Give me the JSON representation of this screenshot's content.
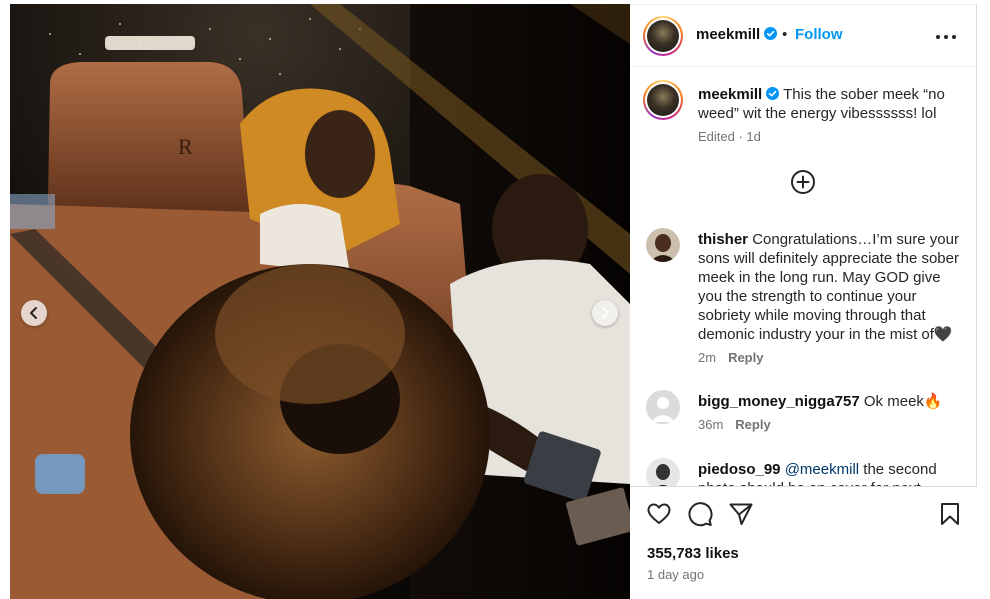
{
  "post": {
    "username": "meekmill",
    "follow_label": "Follow",
    "separator": "•"
  },
  "caption": {
    "username": "meekmill",
    "text": "This the sober meek “no weed” wit the energy vibessssss! lol",
    "meta": "Edited · 1d"
  },
  "comments": [
    {
      "username": "thisher",
      "text": "Congratulations…I’m sure your sons will definitely appreciate the sober meek in the long run. May GOD give you the strength to continue your sobriety while moving through that demonic industry your in the mist of🖤",
      "time": "2m",
      "reply_label": "Reply",
      "avatar": "profile-photo"
    },
    {
      "username": "bigg_money_nigga757",
      "text": "Ok meek🔥",
      "time": "36m",
      "reply_label": "Reply",
      "avatar": "default-avatar-icon"
    },
    {
      "username": "piedoso_99",
      "mention": "@meekmill",
      "text": "the second photo should be on cover for next",
      "avatar": "profile-photo"
    }
  ],
  "actions": {
    "icons": [
      "heart-icon",
      "comment-icon",
      "share-icon",
      "bookmark-icon"
    ]
  },
  "stats": {
    "likes": "355,783 likes",
    "posted": "1 day ago"
  },
  "colors": {
    "link": "#0095f6",
    "verified": "#0095f6",
    "muted": "#737373",
    "border": "#dbdbdb"
  },
  "media": {
    "description_icon": "photo-car-interior",
    "nav": [
      "chevron-left-icon",
      "chevron-right-icon"
    ]
  }
}
